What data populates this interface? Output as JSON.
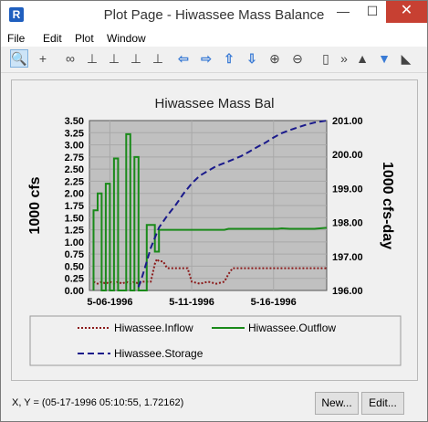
{
  "window": {
    "title": "Plot Page - Hiwassee Mass Balance",
    "minimize": "—",
    "maximize": "☐",
    "close": "✕"
  },
  "menu": [
    "File",
    "Edit",
    "Plot",
    "Window"
  ],
  "toolbar": [
    {
      "name": "zoom-icon",
      "glyph": "🔍"
    },
    {
      "name": "crosshair-icon",
      "glyph": "+"
    },
    {
      "name": "link-icon",
      "glyph": "∞"
    },
    {
      "name": "axis-tool-1-icon",
      "glyph": "⊥"
    },
    {
      "name": "axis-tool-2-icon",
      "glyph": "⊥"
    },
    {
      "name": "axis-tool-3-icon",
      "glyph": "⊥"
    },
    {
      "name": "axis-tool-4-icon",
      "glyph": "⊥"
    },
    {
      "name": "pan-left-icon",
      "glyph": "⇦"
    },
    {
      "name": "pan-right-icon",
      "glyph": "⇨"
    },
    {
      "name": "pan-up-icon",
      "glyph": "⇧"
    },
    {
      "name": "pan-down-icon",
      "glyph": "⇩"
    },
    {
      "name": "zoom-in-icon",
      "glyph": "⊕"
    },
    {
      "name": "zoom-out-icon",
      "glyph": "⊖"
    },
    {
      "name": "panel-icon",
      "glyph": "▯"
    },
    {
      "name": "more-icon",
      "glyph": "»"
    },
    {
      "name": "baseline-icon",
      "glyph": "▲"
    },
    {
      "name": "dropdown-icon",
      "glyph": "▼"
    },
    {
      "name": "fill-icon",
      "glyph": "◣"
    }
  ],
  "chart_data": {
    "type": "line",
    "title": "Hiwassee Mass Bal",
    "ylabel": "1000 cfs",
    "y2label": "1000 cfs-day",
    "xlabel": "",
    "x_ticks": [
      "5-06-1996",
      "5-11-1996",
      "5-16-1996"
    ],
    "y_ticks": [
      "0.00",
      "0.25",
      "0.50",
      "0.75",
      "1.00",
      "1.25",
      "1.50",
      "1.75",
      "2.00",
      "2.25",
      "2.50",
      "2.75",
      "3.00",
      "3.25",
      "3.50"
    ],
    "y2_ticks": [
      "196.00",
      "197.00",
      "198.00",
      "199.00",
      "200.00",
      "201.00"
    ],
    "ylim": [
      0,
      3.5
    ],
    "y2lim": [
      196,
      201
    ],
    "xlim": [
      "1996-05-04 18:00",
      "1996-05-19 06:00"
    ],
    "grid": true,
    "background": "#c0c0c0",
    "series": [
      {
        "name": "Hiwassee.Inflow",
        "color": "#8b1a1a",
        "dash": "dotted",
        "axis": "left",
        "points": [
          [
            "1996-05-05 00:00",
            0.18
          ],
          [
            "1996-05-05 06:00",
            0.14
          ],
          [
            "1996-05-05 12:00",
            0.18
          ],
          [
            "1996-05-05 18:00",
            0.14
          ],
          [
            "1996-05-06 00:00",
            0.18
          ],
          [
            "1996-05-06 06:00",
            0.14
          ],
          [
            "1996-05-06 12:00",
            0.18
          ],
          [
            "1996-05-06 18:00",
            0.14
          ],
          [
            "1996-05-07 00:00",
            0.18
          ],
          [
            "1996-05-07 06:00",
            0.14
          ],
          [
            "1996-05-07 12:00",
            0.18
          ],
          [
            "1996-05-07 18:00",
            0.14
          ],
          [
            "1996-05-08 00:00",
            0.18
          ],
          [
            "1996-05-08 12:00",
            0.18
          ],
          [
            "1996-05-08 18:00",
            0.55
          ],
          [
            "1996-05-08 21:00",
            0.65
          ],
          [
            "1996-05-09 00:00",
            0.6
          ],
          [
            "1996-05-09 06:00",
            0.6
          ],
          [
            "1996-05-09 12:00",
            0.46
          ],
          [
            "1996-05-10 18:00",
            0.46
          ],
          [
            "1996-05-11 00:00",
            0.18
          ],
          [
            "1996-05-11 12:00",
            0.14
          ],
          [
            "1996-05-12 00:00",
            0.18
          ],
          [
            "1996-05-12 12:00",
            0.14
          ],
          [
            "1996-05-13 00:00",
            0.18
          ],
          [
            "1996-05-13 06:00",
            0.34
          ],
          [
            "1996-05-13 12:00",
            0.46
          ],
          [
            "1996-05-19 06:00",
            0.46
          ]
        ]
      },
      {
        "name": "Hiwassee.Outflow",
        "color": "#1a8a1a",
        "dash": "solid",
        "axis": "left",
        "points": [
          [
            "1996-05-05 00:00",
            0.0
          ],
          [
            "1996-05-05 00:00",
            1.65
          ],
          [
            "1996-05-05 06:00",
            1.65
          ],
          [
            "1996-05-05 06:00",
            2.0
          ],
          [
            "1996-05-05 12:00",
            2.0
          ],
          [
            "1996-05-05 12:00",
            0.0
          ],
          [
            "1996-05-05 18:00",
            0.0
          ],
          [
            "1996-05-05 18:00",
            2.2
          ],
          [
            "1996-05-06 00:00",
            2.2
          ],
          [
            "1996-05-06 00:00",
            0.0
          ],
          [
            "1996-05-06 06:00",
            0.0
          ],
          [
            "1996-05-06 06:00",
            2.72
          ],
          [
            "1996-05-06 12:00",
            2.72
          ],
          [
            "1996-05-06 12:00",
            0.0
          ],
          [
            "1996-05-07 00:00",
            0.0
          ],
          [
            "1996-05-07 00:00",
            3.22
          ],
          [
            "1996-05-07 06:00",
            3.22
          ],
          [
            "1996-05-07 06:00",
            0.0
          ],
          [
            "1996-05-07 12:00",
            0.0
          ],
          [
            "1996-05-07 12:00",
            2.75
          ],
          [
            "1996-05-07 18:00",
            2.75
          ],
          [
            "1996-05-07 18:00",
            0.0
          ],
          [
            "1996-05-08 06:00",
            0.0
          ],
          [
            "1996-05-08 06:00",
            1.35
          ],
          [
            "1996-05-08 18:00",
            1.35
          ],
          [
            "1996-05-08 18:00",
            0.8
          ],
          [
            "1996-05-09 00:00",
            0.8
          ],
          [
            "1996-05-09 00:00",
            1.25
          ],
          [
            "1996-05-13 00:00",
            1.25
          ],
          [
            "1996-05-13 06:00",
            1.27
          ],
          [
            "1996-05-16 06:00",
            1.27
          ],
          [
            "1996-05-16 12:00",
            1.28
          ],
          [
            "1996-05-17 00:00",
            1.27
          ],
          [
            "1996-05-18 12:00",
            1.27
          ],
          [
            "1996-05-19 06:00",
            1.29
          ]
        ]
      },
      {
        "name": "Hiwassee.Storage",
        "color": "#1a1a8b",
        "dash": "dashed",
        "axis": "right",
        "points": [
          [
            "1996-05-07 18:00",
            196.1
          ],
          [
            "1996-05-08 00:00",
            196.45
          ],
          [
            "1996-05-08 06:00",
            196.85
          ],
          [
            "1996-05-08 12:00",
            197.25
          ],
          [
            "1996-05-09 00:00",
            197.85
          ],
          [
            "1996-05-09 12:00",
            198.2
          ],
          [
            "1996-05-10 00:00",
            198.5
          ],
          [
            "1996-05-10 12:00",
            198.85
          ],
          [
            "1996-05-11 00:00",
            199.15
          ],
          [
            "1996-05-11 12:00",
            199.38
          ],
          [
            "1996-05-12 00:00",
            199.52
          ],
          [
            "1996-05-12 12:00",
            199.66
          ],
          [
            "1996-05-13 00:00",
            199.75
          ],
          [
            "1996-05-13 12:00",
            199.85
          ],
          [
            "1996-05-14 00:00",
            199.95
          ],
          [
            "1996-05-14 12:00",
            200.08
          ],
          [
            "1996-05-15 00:00",
            200.22
          ],
          [
            "1996-05-15 12:00",
            200.35
          ],
          [
            "1996-05-16 00:00",
            200.5
          ],
          [
            "1996-05-16 12:00",
            200.63
          ],
          [
            "1996-05-17 00:00",
            200.72
          ],
          [
            "1996-05-17 12:00",
            200.8
          ],
          [
            "1996-05-18 00:00",
            200.88
          ],
          [
            "1996-05-18 12:00",
            200.94
          ],
          [
            "1996-05-19 06:00",
            201.0
          ]
        ]
      }
    ]
  },
  "status": "X, Y = (05-17-1996 05:10:55, 1.72162)",
  "buttons": {
    "new": "New...",
    "edit": "Edit..."
  }
}
